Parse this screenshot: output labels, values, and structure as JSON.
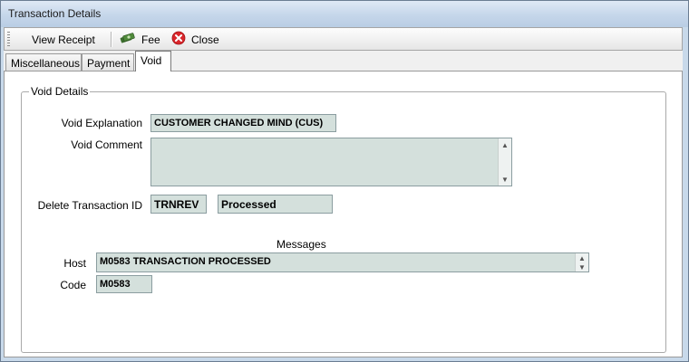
{
  "window": {
    "title": "Transaction Details"
  },
  "toolbar": {
    "view_receipt_label": "View Receipt",
    "fee_label": "Fee",
    "close_label": "Close",
    "fee_icon": "money-icon",
    "close_icon": "close-icon"
  },
  "tabs": [
    {
      "label": "Miscellaneous"
    },
    {
      "label": "Payment"
    },
    {
      "label": "Void"
    }
  ],
  "void_details": {
    "group_label": "Void Details",
    "explanation_label": "Void Explanation",
    "explanation_value": "CUSTOMER CHANGED MIND (CUS)",
    "comment_label": "Void Comment",
    "comment_value": "",
    "delete_id_label": "Delete Transaction ID",
    "delete_id_value": "TRNREV",
    "status_value": "Processed"
  },
  "messages": {
    "heading": "Messages",
    "host_label": "Host",
    "host_value": "M0583 TRANSACTION PROCESSED",
    "code_label": "Code",
    "code_value": "M0583"
  },
  "colors": {
    "field_bg": "#d4e0dc",
    "window_bg": "#c8d9ea",
    "close_red": "#d9262b"
  }
}
